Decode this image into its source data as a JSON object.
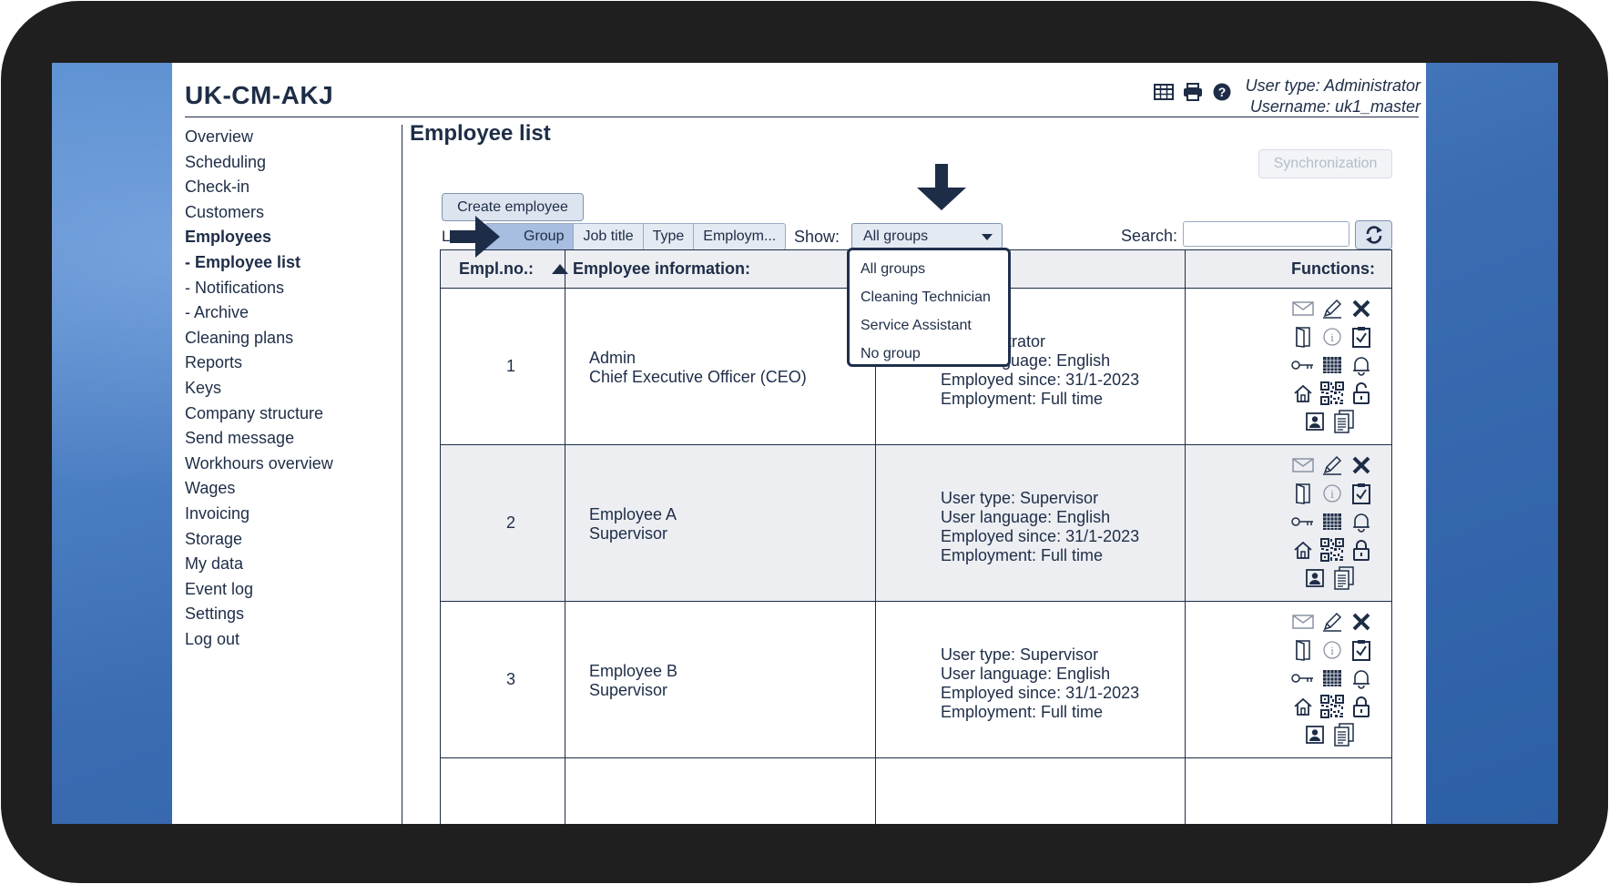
{
  "app": {
    "title": "UK-CM-AKJ",
    "user_type": "User type: Administrator",
    "username": "Username: uk1_master"
  },
  "top_icons": [
    "table-icon",
    "print-icon",
    "help-icon"
  ],
  "sidebar": {
    "items": [
      {
        "label": "Overview"
      },
      {
        "label": "Scheduling"
      },
      {
        "label": "Check-in"
      },
      {
        "label": "Customers"
      },
      {
        "label": "Employees",
        "active": true
      },
      {
        "label": "- Employee list",
        "active": true
      },
      {
        "label": "- Notifications"
      },
      {
        "label": "- Archive"
      },
      {
        "label": "Cleaning plans"
      },
      {
        "label": "Reports"
      },
      {
        "label": "Keys"
      },
      {
        "label": "Company structure"
      },
      {
        "label": "Send message"
      },
      {
        "label": "Workhours overview"
      },
      {
        "label": "Wages"
      },
      {
        "label": "Invoicing"
      },
      {
        "label": "Storage"
      },
      {
        "label": "My data"
      },
      {
        "label": "Event log"
      },
      {
        "label": "Settings"
      },
      {
        "label": "Log out"
      }
    ]
  },
  "main": {
    "title": "Employee list",
    "sync_label": "Synchronization",
    "create_label": "Create employee",
    "list_prefix": "L",
    "list_by": [
      "Group",
      "Job title",
      "Type",
      "Employm..."
    ],
    "list_by_selected": "Group",
    "show_label": "Show:",
    "show_value": "All groups",
    "show_options": [
      "All groups",
      "Cleaning Technician",
      "Service Assistant",
      "No group"
    ],
    "search_label": "Search:",
    "search_value": ""
  },
  "table": {
    "headers": {
      "no": "Empl.no.:",
      "info": "Employee information:",
      "functions": "Functions:"
    },
    "sort": "ascending",
    "function_icons": [
      "mail-icon",
      "edit-icon",
      "delete-icon",
      "door-icon",
      "info-icon",
      "checklist-icon",
      "key-icon",
      "calendar-grid-icon",
      "bell-icon",
      "home-icon",
      "qr-code-icon",
      "lock-icon",
      "contact-card-icon",
      "documents-icon"
    ],
    "rows": [
      {
        "no": "1",
        "name": "Admin",
        "title": "Chief Executive Officer (CEO)",
        "details": [
          ": Administrator",
          "User language: English",
          "Employed since: 31/1-2023",
          "Employment: Full time"
        ],
        "lock_state": "unlocked"
      },
      {
        "no": "2",
        "name": "Employee A",
        "title": "Supervisor",
        "details": [
          "User type: Supervisor",
          "User language: English",
          "Employed since: 31/1-2023",
          "Employment: Full time"
        ],
        "lock_state": "locked"
      },
      {
        "no": "3",
        "name": "Employee B",
        "title": "Supervisor",
        "details": [
          "User type: Supervisor",
          "User language: English",
          "Employed since: 31/1-2023",
          "Employment: Full time"
        ],
        "lock_state": "locked"
      }
    ]
  },
  "colors": {
    "navy": "#1e2d47",
    "row_alt": "#eceef2",
    "segment_selected": "#a7bee0",
    "desktop_blue": "#3c6fb4"
  }
}
